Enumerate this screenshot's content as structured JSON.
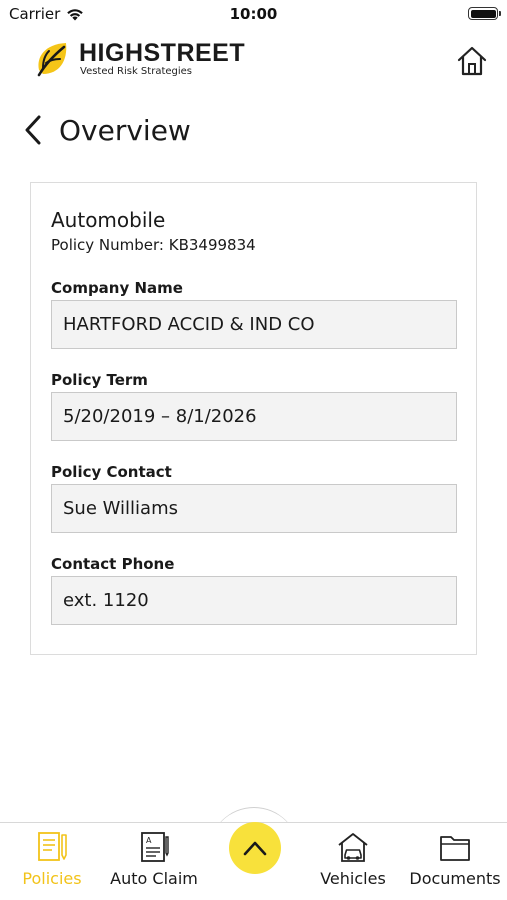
{
  "status_bar": {
    "carrier": "Carrier",
    "time": "10:00"
  },
  "header": {
    "brand": "HIGHSTREET",
    "tagline": "Vested Risk Strategies",
    "home_icon": "home-icon",
    "logo_icon": "leaf-logo-icon"
  },
  "page": {
    "title": "Overview",
    "back_icon": "chevron-left-icon"
  },
  "policy": {
    "type": "Automobile",
    "number_line": "Policy Number: KB3499834",
    "fields": [
      {
        "label": "Company Name",
        "value": "HARTFORD ACCID & IND CO"
      },
      {
        "label": "Policy Term",
        "value": "5/20/2019 – 8/1/2026"
      },
      {
        "label": "Policy Contact",
        "value": "Sue Williams"
      },
      {
        "label": "Contact Phone",
        "value": "ext. 1120"
      }
    ]
  },
  "bottom_nav": {
    "items": [
      {
        "label": "Policies",
        "icon": "policies-icon",
        "active": true
      },
      {
        "label": "Auto Claim",
        "icon": "auto-claim-icon",
        "active": false
      },
      {
        "label": "Vehicles",
        "icon": "vehicles-icon",
        "active": false
      },
      {
        "label": "Documents",
        "icon": "documents-icon",
        "active": false
      }
    ],
    "center_button_icon": "chevron-up-icon"
  },
  "colors": {
    "accent": "#f2c31a",
    "fab": "#f8e13b",
    "field_bg": "#f3f3f3"
  }
}
